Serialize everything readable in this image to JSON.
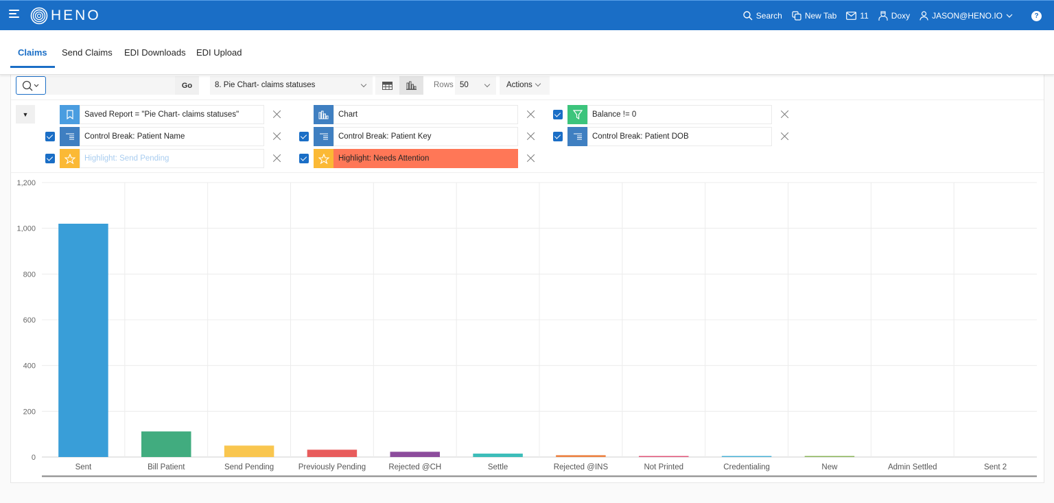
{
  "header": {
    "app_name": "HENO",
    "actions": {
      "search": "Search",
      "new_tab": "New Tab",
      "messages_count": "11",
      "doxy": "Doxy",
      "user": "JASON@HENO.IO",
      "help": "?"
    }
  },
  "tabs": [
    {
      "label": "Claims",
      "active": true
    },
    {
      "label": "Send Claims",
      "active": false
    },
    {
      "label": "EDI Downloads",
      "active": false
    },
    {
      "label": "EDI Upload",
      "active": false
    }
  ],
  "toolbar": {
    "search_value": "",
    "go_label": "Go",
    "report_selected": "8. Pie Chart- claims statuses",
    "rows_label": "Rows",
    "rows_value": "50",
    "actions_label": "Actions",
    "view_mode": "chart"
  },
  "filters": [
    {
      "type": "saved-report",
      "label": "Saved Report = \"Pie Chart- claims statuses\"",
      "checkbox": false,
      "icon": "bookmark-icon",
      "color": "#4a9de0"
    },
    {
      "type": "chart",
      "label": "Chart",
      "checkbox": false,
      "icon": "bar-chart-icon",
      "color": "#3f7fc1"
    },
    {
      "type": "filter",
      "label": "Balance != 0",
      "checkbox": true,
      "icon": "funnel-icon",
      "color": "#3cc47c"
    },
    {
      "type": "control-break",
      "label": "Control Break: Patient Name",
      "checkbox": true,
      "icon": "control-break-icon",
      "color": "#3f7fc1"
    },
    {
      "type": "control-break",
      "label": "Control Break: Patient Key",
      "checkbox": true,
      "icon": "control-break-icon",
      "color": "#3f7fc1"
    },
    {
      "type": "control-break",
      "label": "Control Break: Patient DOB",
      "checkbox": true,
      "icon": "control-break-icon",
      "color": "#3f7fc1"
    },
    {
      "type": "highlight",
      "label": "Highlight: Send Pending",
      "checkbox": true,
      "icon": "star-icon",
      "color": "#fbb935",
      "label_color": "#a9cdf0"
    },
    {
      "type": "highlight",
      "label": "Highlight: Needs Attention",
      "checkbox": true,
      "icon": "star-icon",
      "color": "#fbb935",
      "label_bg": "#ff7757"
    }
  ],
  "chart_data": {
    "type": "bar",
    "title": "",
    "xlabel": "",
    "ylabel": "",
    "categories": [
      "Sent",
      "Bill Patient",
      "Send Pending",
      "Previously Pending",
      "Rejected @CH",
      "Settle",
      "Rejected @INS",
      "Not Printed",
      "Credentialing",
      "New",
      "Admin Settled",
      "Sent 2"
    ],
    "values": [
      1020,
      112,
      50,
      32,
      23,
      15,
      8,
      4,
      3,
      2,
      0,
      0
    ],
    "colors": [
      "#399ed8",
      "#41ac7f",
      "#f9c64f",
      "#e85c5c",
      "#8c4c9c",
      "#3dbdb9",
      "#ec8344",
      "#e0567a",
      "#4ab1d6",
      "#8bb45a",
      "#999999",
      "#999999"
    ],
    "ylim": [
      0,
      1200
    ],
    "yticks": [
      0,
      200,
      400,
      600,
      800,
      1000,
      1200
    ],
    "ytick_labels": [
      "0",
      "200",
      "400",
      "600",
      "800",
      "1,000",
      "1,200"
    ],
    "grid": true,
    "legend": "none"
  }
}
